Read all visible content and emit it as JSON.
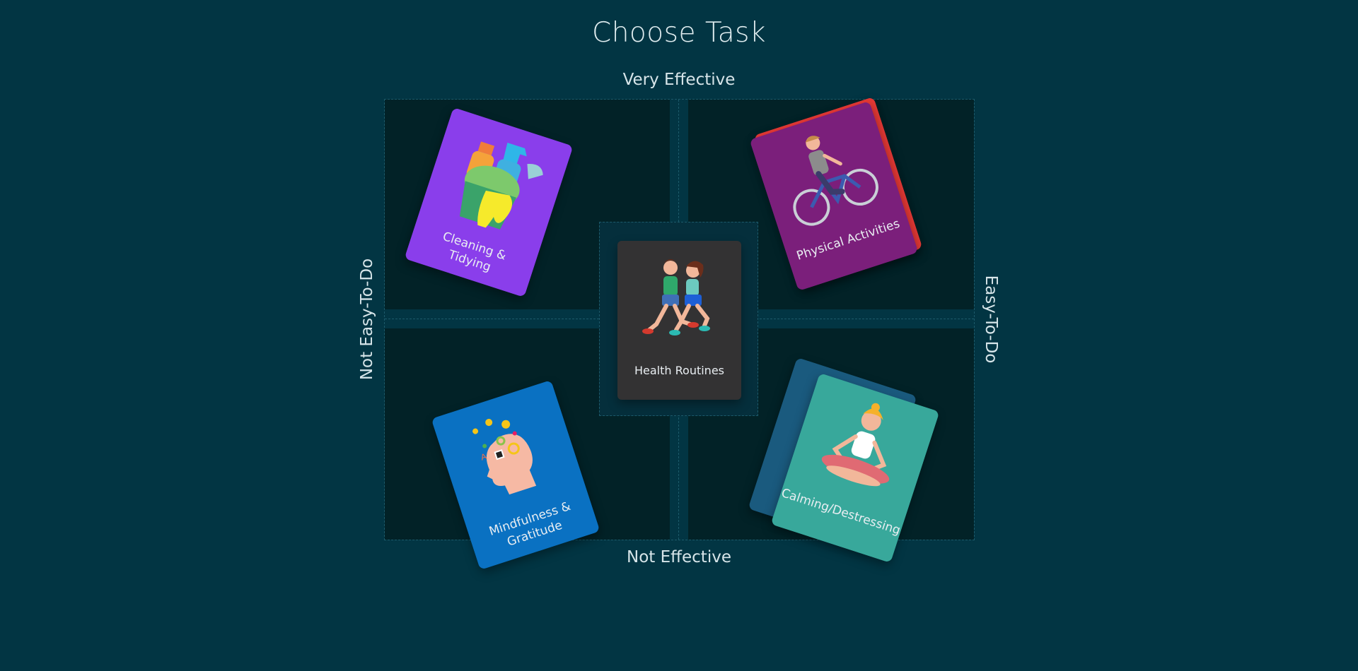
{
  "page": {
    "title": "Choose Task"
  },
  "axes": {
    "top": "Very Effective",
    "bottom": "Not Effective",
    "left": "Not Easy-To-Do",
    "right": "Easy-To-Do"
  },
  "center_card": {
    "label": "Health Routines",
    "icon": "runners-icon",
    "color": "#333233"
  },
  "cards": {
    "cleaning": {
      "label": "Cleaning & Tidying",
      "icon": "cleaning-supplies-icon",
      "color": "#8a3eeb"
    },
    "physical": {
      "label": "Physical Activities",
      "icon": "cyclist-icon",
      "color": "#7b1f7b"
    },
    "mindfulness": {
      "label": "Mindfulness & Gratitude",
      "icon": "open-head-icon",
      "color": "#0a71c2"
    },
    "calming": {
      "label": "Calming/Destressing",
      "icon": "meditation-icon",
      "color": "#38a89b"
    }
  },
  "colors": {
    "background": "#023543",
    "quadrant": "#022227",
    "stack_red": "#e53935",
    "stack_blue": "#1a5a7e"
  }
}
